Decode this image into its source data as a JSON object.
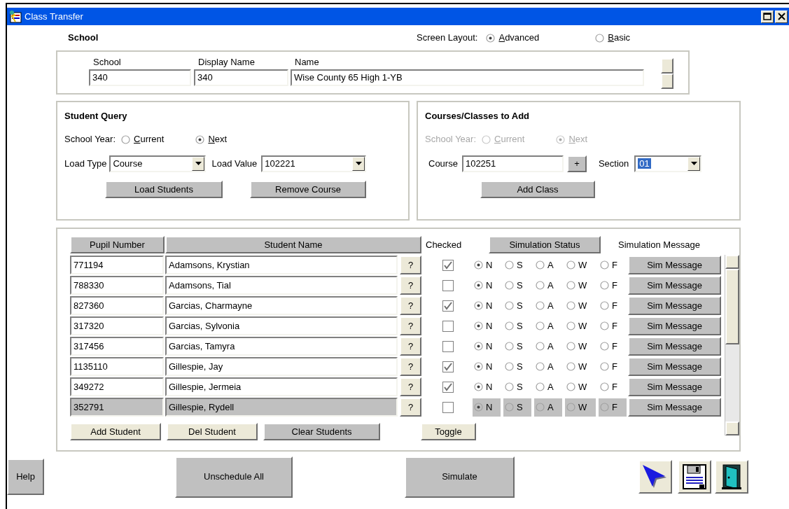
{
  "window": {
    "title": "Class Transfer"
  },
  "school_section": {
    "heading": "School",
    "screen_layout": {
      "label": "Screen Layout:",
      "options": [
        {
          "label": "Advanced",
          "selected": true
        },
        {
          "label": "Basic",
          "selected": false
        }
      ]
    },
    "fields": [
      {
        "label": "School",
        "value": "340"
      },
      {
        "label": "Display Name",
        "value": "340"
      },
      {
        "label": "Name",
        "value": "Wise County 65 High 1-YB"
      }
    ]
  },
  "student_query": {
    "heading": "Student Query",
    "school_year": {
      "label": "School Year:",
      "disabled": false,
      "options": [
        {
          "label": "Current",
          "selected": false
        },
        {
          "label": "Next",
          "selected": true
        }
      ]
    },
    "load_type": {
      "label": "Load Type",
      "value": "Course"
    },
    "load_value": {
      "label": "Load Value",
      "value": "102221"
    },
    "buttons": [
      "Load Students",
      "Remove Course"
    ]
  },
  "courses_to_add": {
    "heading": "Courses/Classes to Add",
    "school_year": {
      "label": "School Year:",
      "disabled": true,
      "options": [
        {
          "label": "Current",
          "selected": false
        },
        {
          "label": "Next",
          "selected": true
        }
      ]
    },
    "course": {
      "label": "Course",
      "value": "102251",
      "button": "+"
    },
    "section": {
      "label": "Section",
      "value": "01",
      "focused": true
    },
    "buttons": [
      "Add Class"
    ]
  },
  "students": {
    "columns": [
      {
        "label": "Pupil Number",
        "kind": "header"
      },
      {
        "label": "Student Name",
        "kind": "header"
      },
      {
        "label": "Checked",
        "kind": "label"
      },
      {
        "label": "Simulation Status",
        "kind": "button"
      },
      {
        "label": "Simulation Message",
        "kind": "label"
      }
    ],
    "rows": [
      {
        "pupil": "771194",
        "name": "Adamsons, Krystian",
        "help": "?",
        "checked": true,
        "selected": false,
        "status": [
          {
            "label": "N",
            "selected": true
          },
          {
            "label": "S",
            "selected": false
          },
          {
            "label": "A",
            "selected": false
          },
          {
            "label": "W",
            "selected": false
          },
          {
            "label": "F",
            "selected": false
          }
        ],
        "message": "Sim Message"
      },
      {
        "pupil": "788330",
        "name": "Adamsons, Tial",
        "help": "?",
        "checked": false,
        "selected": false,
        "status": [
          {
            "label": "N",
            "selected": true
          },
          {
            "label": "S",
            "selected": false
          },
          {
            "label": "A",
            "selected": false
          },
          {
            "label": "W",
            "selected": false
          },
          {
            "label": "F",
            "selected": false
          }
        ],
        "message": "Sim Message"
      },
      {
        "pupil": "827360",
        "name": "Garcias, Charmayne",
        "help": "?",
        "checked": true,
        "selected": false,
        "status": [
          {
            "label": "N",
            "selected": true
          },
          {
            "label": "S",
            "selected": false
          },
          {
            "label": "A",
            "selected": false
          },
          {
            "label": "W",
            "selected": false
          },
          {
            "label": "F",
            "selected": false
          }
        ],
        "message": "Sim Message"
      },
      {
        "pupil": "317320",
        "name": "Garcias, Sylvonia",
        "help": "?",
        "checked": false,
        "selected": false,
        "status": [
          {
            "label": "N",
            "selected": true
          },
          {
            "label": "S",
            "selected": false
          },
          {
            "label": "A",
            "selected": false
          },
          {
            "label": "W",
            "selected": false
          },
          {
            "label": "F",
            "selected": false
          }
        ],
        "message": "Sim Message"
      },
      {
        "pupil": "317456",
        "name": "Garcias, Tamyra",
        "help": "?",
        "checked": false,
        "selected": false,
        "status": [
          {
            "label": "N",
            "selected": true
          },
          {
            "label": "S",
            "selected": false
          },
          {
            "label": "A",
            "selected": false
          },
          {
            "label": "W",
            "selected": false
          },
          {
            "label": "F",
            "selected": false
          }
        ],
        "message": "Sim Message"
      },
      {
        "pupil": "1135110",
        "name": "Gillespie, Jay",
        "help": "?",
        "checked": true,
        "selected": false,
        "status": [
          {
            "label": "N",
            "selected": true
          },
          {
            "label": "S",
            "selected": false
          },
          {
            "label": "A",
            "selected": false
          },
          {
            "label": "W",
            "selected": false
          },
          {
            "label": "F",
            "selected": false
          }
        ],
        "message": "Sim Message"
      },
      {
        "pupil": "349272",
        "name": "Gillespie, Jermeia",
        "help": "?",
        "checked": true,
        "selected": false,
        "status": [
          {
            "label": "N",
            "selected": true
          },
          {
            "label": "S",
            "selected": false
          },
          {
            "label": "A",
            "selected": false
          },
          {
            "label": "W",
            "selected": false
          },
          {
            "label": "F",
            "selected": false
          }
        ],
        "message": "Sim Message"
      },
      {
        "pupil": "352791",
        "name": "Gillespie, Rydell",
        "help": "?",
        "checked": false,
        "selected": true,
        "status": [
          {
            "label": "N",
            "selected": true
          },
          {
            "label": "S",
            "selected": false
          },
          {
            "label": "A",
            "selected": false
          },
          {
            "label": "W",
            "selected": false
          },
          {
            "label": "F",
            "selected": false
          }
        ],
        "message": "Sim Message"
      }
    ],
    "buttons": [
      {
        "label": "Add Student",
        "kind": "light"
      },
      {
        "label": "Del Student",
        "kind": "light"
      },
      {
        "label": "Clear Students",
        "kind": "grey"
      }
    ],
    "toggle": "Toggle"
  },
  "footer": {
    "buttons": [
      "Help",
      "Unschedule All",
      "Simulate"
    ]
  }
}
